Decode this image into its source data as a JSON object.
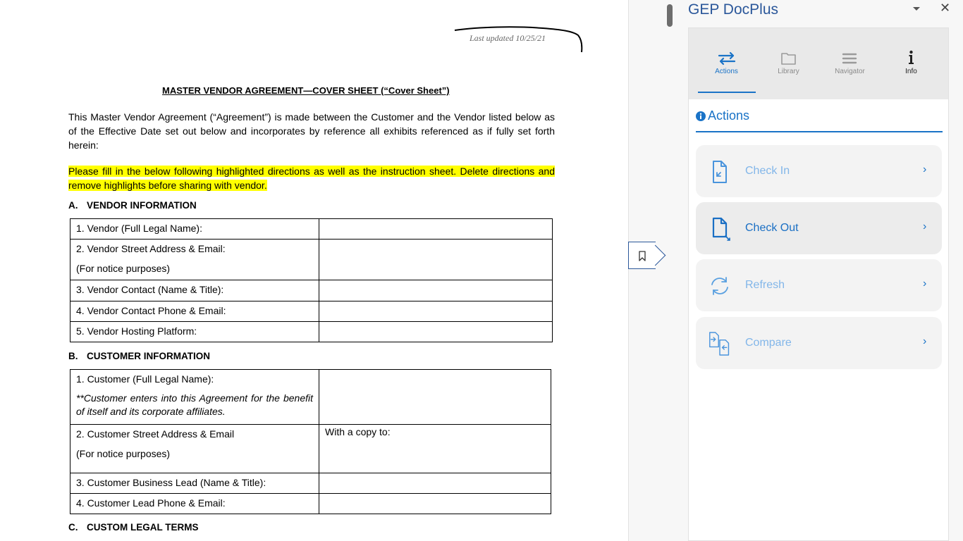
{
  "document": {
    "last_updated": "Last updated 10/25/21",
    "title": "MASTER VENDOR AGREEMENT—COVER SHEET (“Cover Sheet”)",
    "intro": "This Master Vendor Agreement (“Agreement”) is made between the Customer and the Vendor listed below as of the Effective Date set out below and incorporates by reference all exhibits referenced as if fully set forth herein:",
    "highlight": "Please fill in the below following highlighted directions as well as the instruction sheet. Delete directions and remove highlights before sharing with vendor.",
    "section_a": {
      "letter": "A.",
      "title": "VENDOR INFORMATION"
    },
    "vendor_rows": [
      "1. Vendor (Full Legal Name):",
      "2.  Vendor Street Address & Email:",
      "(For notice purposes)",
      "3. Vendor Contact (Name & Title):",
      "4. Vendor Contact Phone & Email:",
      "5.  Vendor Hosting Platform:"
    ],
    "section_b": {
      "letter": "B.",
      "title": "CUSTOMER INFORMATION"
    },
    "customer_rows": {
      "r1": "1. Customer (Full Legal Name):",
      "r1_note": "**Customer enters into this Agreement for the benefit of itself and its corporate affiliates.",
      "r2": "2. Customer Street Address & Email",
      "r2_sub": "(For notice purposes)",
      "r2_value": "With a copy to:",
      "r3": "3. Customer Business Lead (Name & Title):",
      "r4": "4. Customer Lead Phone & Email:"
    },
    "section_c": {
      "letter": "C.",
      "title": "CUSTOM LEGAL TERMS"
    }
  },
  "pane": {
    "title": "GEP DocPlus",
    "tabs": [
      {
        "label": "Actions",
        "icon": "swap-arrows-icon"
      },
      {
        "label": "Library",
        "icon": "folder-icon"
      },
      {
        "label": "Navigator",
        "icon": "menu-lines-icon"
      },
      {
        "label": "Info",
        "icon": "info-icon"
      }
    ],
    "section_title": "Actions",
    "actions": [
      {
        "label": "Check In",
        "icon": "check-in-icon"
      },
      {
        "label": "Check Out",
        "icon": "check-out-icon"
      },
      {
        "label": "Refresh",
        "icon": "refresh-icon"
      },
      {
        "label": "Compare",
        "icon": "compare-icon"
      }
    ]
  },
  "colors": {
    "accent": "#1a73c7",
    "word_blue": "#2b579a",
    "highlight": "#ffff00"
  }
}
